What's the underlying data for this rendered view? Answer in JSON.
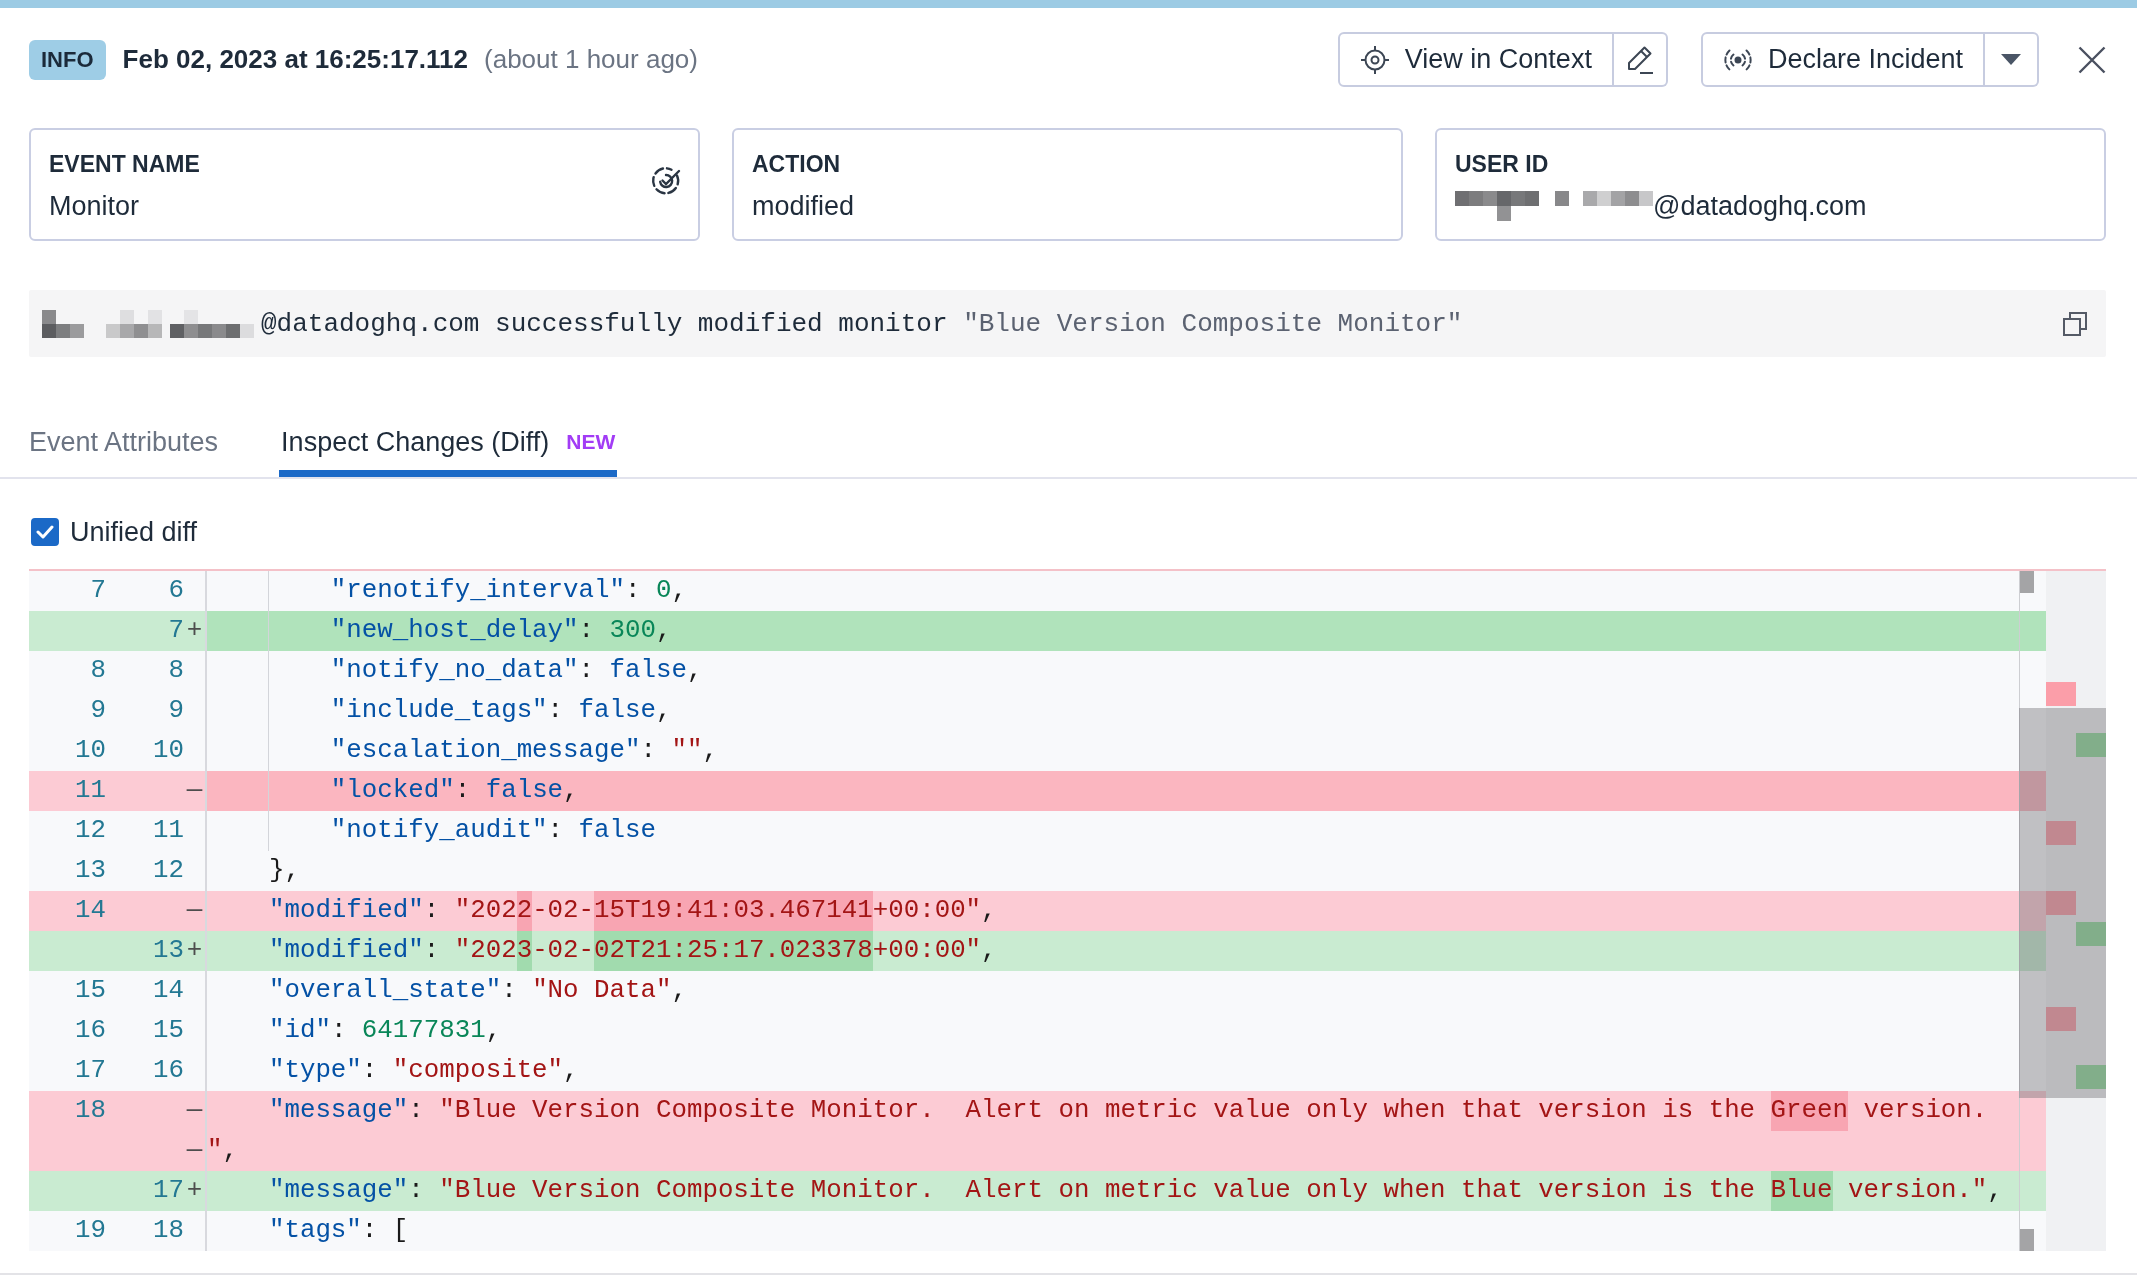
{
  "header": {
    "badge": "INFO",
    "timestamp": "Feb 02, 2023 at 16:25:17.112",
    "relative_time": "(about 1 hour ago)"
  },
  "actions": [
    {
      "kind": "context",
      "label": "View in Context"
    },
    {
      "kind": "incident",
      "label": "Declare Incident"
    }
  ],
  "cards": [
    {
      "kind": "monitor",
      "label": "EVENT NAME",
      "value": "Monitor",
      "redacted": false
    },
    {
      "kind": "plain",
      "label": "ACTION",
      "value": "modified",
      "redacted": false
    },
    {
      "kind": "plain",
      "label": "USER ID",
      "value": "@datadoghq.com",
      "redacted": true
    }
  ],
  "message": {
    "redacted": true,
    "text": "@datadoghq.com successfully modified monitor",
    "quoted": "\"Blue Version Composite Monitor\""
  },
  "tabs": [
    {
      "label": "Event Attributes",
      "selected": false
    },
    {
      "label": "Inspect Changes (Diff)",
      "selected": true,
      "badge": "NEW"
    }
  ],
  "unified_diff": {
    "label": "Unified diff",
    "checked": true
  },
  "diff": {
    "lines": [
      {
        "old": "7",
        "new": "6",
        "kind": "context",
        "indent_guide": true,
        "whole_line_changed": false,
        "code": [
          {
            "kind": "key",
            "text": "        \"renotify_interval\"",
            "changed": false
          },
          {
            "kind": "punct",
            "text": ": ",
            "changed": false
          },
          {
            "kind": "number",
            "text": "0",
            "changed": false
          },
          {
            "kind": "punct",
            "text": ",",
            "changed": false
          }
        ]
      },
      {
        "new": "7",
        "kind": "added",
        "marker": "+",
        "indent_guide": true,
        "whole_line_changed": true,
        "code": [
          {
            "kind": "key",
            "text": "        \"new_host_delay\"",
            "changed": false
          },
          {
            "kind": "punct",
            "text": ": ",
            "changed": false
          },
          {
            "kind": "number",
            "text": "300",
            "changed": false
          },
          {
            "kind": "punct",
            "text": ",",
            "changed": false
          }
        ]
      },
      {
        "old": "8",
        "new": "8",
        "kind": "context",
        "indent_guide": true,
        "whole_line_changed": false,
        "code": [
          {
            "kind": "key",
            "text": "        \"notify_no_data\"",
            "changed": false
          },
          {
            "kind": "punct",
            "text": ": ",
            "changed": false
          },
          {
            "kind": "literal",
            "text": "false",
            "changed": false
          },
          {
            "kind": "punct",
            "text": ",",
            "changed": false
          }
        ]
      },
      {
        "old": "9",
        "new": "9",
        "kind": "context",
        "indent_guide": true,
        "whole_line_changed": false,
        "code": [
          {
            "kind": "key",
            "text": "        \"include_tags\"",
            "changed": false
          },
          {
            "kind": "punct",
            "text": ": ",
            "changed": false
          },
          {
            "kind": "literal",
            "text": "false",
            "changed": false
          },
          {
            "kind": "punct",
            "text": ",",
            "changed": false
          }
        ]
      },
      {
        "old": "10",
        "new": "10",
        "kind": "context",
        "indent_guide": true,
        "whole_line_changed": false,
        "code": [
          {
            "kind": "key",
            "text": "        \"escalation_message\"",
            "changed": false
          },
          {
            "kind": "punct",
            "text": ": ",
            "changed": false
          },
          {
            "kind": "string",
            "text": "\"\"",
            "changed": false
          },
          {
            "kind": "punct",
            "text": ",",
            "changed": false
          }
        ]
      },
      {
        "old": "11",
        "kind": "removed",
        "marker": "—",
        "indent_guide": true,
        "whole_line_changed": true,
        "code": [
          {
            "kind": "key",
            "text": "        \"locked\"",
            "changed": false
          },
          {
            "kind": "punct",
            "text": ": ",
            "changed": false
          },
          {
            "kind": "literal",
            "text": "false",
            "changed": false
          },
          {
            "kind": "punct",
            "text": ",",
            "changed": false
          }
        ]
      },
      {
        "old": "12",
        "new": "11",
        "kind": "context",
        "indent_guide": true,
        "whole_line_changed": false,
        "code": [
          {
            "kind": "key",
            "text": "        \"notify_audit\"",
            "changed": false
          },
          {
            "kind": "punct",
            "text": ": ",
            "changed": false
          },
          {
            "kind": "literal",
            "text": "false",
            "changed": false
          }
        ]
      },
      {
        "old": "13",
        "new": "12",
        "kind": "context",
        "indent_guide": false,
        "whole_line_changed": false,
        "code": [
          {
            "kind": "punct",
            "text": "    },",
            "changed": false
          }
        ]
      },
      {
        "old": "14",
        "kind": "removed",
        "marker": "—",
        "indent_guide": false,
        "whole_line_changed": false,
        "code": [
          {
            "kind": "key",
            "text": "    \"modified\"",
            "changed": false
          },
          {
            "kind": "punct",
            "text": ": ",
            "changed": false
          },
          {
            "kind": "string",
            "text": "\"202",
            "changed": false
          },
          {
            "kind": "string",
            "text": "2",
            "changed": true
          },
          {
            "kind": "string",
            "text": "-02-",
            "changed": false
          },
          {
            "kind": "string",
            "text": "15T19:41:03.467141",
            "changed": true
          },
          {
            "kind": "string",
            "text": "+00:00\"",
            "changed": false
          },
          {
            "kind": "punct",
            "text": ",",
            "changed": false
          }
        ]
      },
      {
        "new": "13",
        "kind": "added",
        "marker": "+",
        "indent_guide": false,
        "whole_line_changed": false,
        "code": [
          {
            "kind": "key",
            "text": "    \"modified\"",
            "changed": false
          },
          {
            "kind": "punct",
            "text": ": ",
            "changed": false
          },
          {
            "kind": "string",
            "text": "\"202",
            "changed": false
          },
          {
            "kind": "string",
            "text": "3",
            "changed": true
          },
          {
            "kind": "string",
            "text": "-02-",
            "changed": false
          },
          {
            "kind": "string",
            "text": "02T21:25:17.023378",
            "changed": true
          },
          {
            "kind": "string",
            "text": "+00:00\"",
            "changed": false
          },
          {
            "kind": "punct",
            "text": ",",
            "changed": false
          }
        ]
      },
      {
        "old": "15",
        "new": "14",
        "kind": "context",
        "indent_guide": false,
        "whole_line_changed": false,
        "code": [
          {
            "kind": "key",
            "text": "    \"overall_state\"",
            "changed": false
          },
          {
            "kind": "punct",
            "text": ": ",
            "changed": false
          },
          {
            "kind": "string",
            "text": "\"No Data\"",
            "changed": false
          },
          {
            "kind": "punct",
            "text": ",",
            "changed": false
          }
        ]
      },
      {
        "old": "16",
        "new": "15",
        "kind": "context",
        "indent_guide": false,
        "whole_line_changed": false,
        "code": [
          {
            "kind": "key",
            "text": "    \"id\"",
            "changed": false
          },
          {
            "kind": "punct",
            "text": ": ",
            "changed": false
          },
          {
            "kind": "number",
            "text": "64177831",
            "changed": false
          },
          {
            "kind": "punct",
            "text": ",",
            "changed": false
          }
        ]
      },
      {
        "old": "17",
        "new": "16",
        "kind": "context",
        "indent_guide": false,
        "whole_line_changed": false,
        "code": [
          {
            "kind": "key",
            "text": "    \"type\"",
            "changed": false
          },
          {
            "kind": "punct",
            "text": ": ",
            "changed": false
          },
          {
            "kind": "string",
            "text": "\"composite\"",
            "changed": false
          },
          {
            "kind": "punct",
            "text": ",",
            "changed": false
          }
        ]
      },
      {
        "old": "18",
        "kind": "removed",
        "marker": "—",
        "indent_guide": false,
        "whole_line_changed": false,
        "code": [
          {
            "kind": "key",
            "text": "    \"message\"",
            "changed": false
          },
          {
            "kind": "punct",
            "text": ": ",
            "changed": false
          },
          {
            "kind": "string",
            "text": "\"Blue Version Composite Monitor.  Alert on metric value only when that version is the ",
            "changed": false
          },
          {
            "kind": "string",
            "text": "Green",
            "changed": true
          },
          {
            "kind": "string",
            "text": " version.",
            "changed": false
          }
        ],
        "continuation": {
          "marker": "—",
          "code": [
            {
              "kind": "string",
              "text": "\"",
              "changed": false
            },
            {
              "kind": "punct",
              "text": ",",
              "changed": false
            }
          ]
        }
      },
      {
        "new": "17",
        "kind": "added",
        "marker": "+",
        "indent_guide": false,
        "whole_line_changed": false,
        "code": [
          {
            "kind": "key",
            "text": "    \"message\"",
            "changed": false
          },
          {
            "kind": "punct",
            "text": ": ",
            "changed": false
          },
          {
            "kind": "string",
            "text": "\"Blue Version Composite Monitor.  Alert on metric value only when that version is the ",
            "changed": false
          },
          {
            "kind": "string",
            "text": "Blue",
            "changed": true
          },
          {
            "kind": "string",
            "text": " version.\"",
            "changed": false
          },
          {
            "kind": "punct",
            "text": ",",
            "changed": false
          }
        ]
      },
      {
        "old": "19",
        "new": "18",
        "kind": "context",
        "indent_guide": false,
        "whole_line_changed": false,
        "code": [
          {
            "kind": "key",
            "text": "    \"tags\"",
            "changed": false
          },
          {
            "kind": "punct",
            "text": ": ",
            "changed": false
          },
          {
            "kind": "punct",
            "text": "[",
            "changed": false
          }
        ]
      }
    ],
    "overview_marks": [
      {
        "kind": "removed"
      },
      {
        "kind": "added"
      },
      {
        "kind": "removed"
      },
      {
        "kind": "removed"
      },
      {
        "kind": "added"
      },
      {
        "kind": "removed"
      },
      {
        "kind": "added"
      }
    ]
  }
}
